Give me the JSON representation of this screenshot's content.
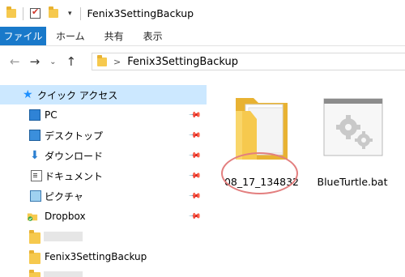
{
  "window": {
    "title": "Fenix3SettingBackup",
    "qa_dropdown": "▾"
  },
  "ribbon": {
    "tabs": [
      "ファイル",
      "ホーム",
      "共有",
      "表示"
    ]
  },
  "address": {
    "back": "←",
    "forward": "→",
    "recent": "⌄",
    "up": "↑",
    "separator": ">",
    "crumb": "Fenix3SettingBackup"
  },
  "nav": {
    "items": [
      {
        "label": "クイック アクセス",
        "icon": "star-icon",
        "selected": true
      },
      {
        "label": "PC",
        "icon": "pc-icon",
        "pinned": true
      },
      {
        "label": "デスクトップ",
        "icon": "desktop-icon",
        "pinned": true
      },
      {
        "label": "ダウンロード",
        "icon": "download-icon",
        "pinned": true
      },
      {
        "label": "ドキュメント",
        "icon": "documents-icon",
        "pinned": true
      },
      {
        "label": "ピクチャ",
        "icon": "pictures-icon",
        "pinned": true
      },
      {
        "label": "Dropbox",
        "icon": "dropbox-icon",
        "pinned": true
      },
      {
        "label": "",
        "icon": "folder-icon",
        "blurred": true
      },
      {
        "label": "Fenix3SettingBackup",
        "icon": "folder-icon"
      },
      {
        "label": "",
        "icon": "folder-icon",
        "blurred": true
      }
    ],
    "pin_glyph": "📌"
  },
  "content": {
    "items": [
      {
        "name": "08_17_134832",
        "type": "folder",
        "highlighted": true
      },
      {
        "name": "BlueTurtle.bat",
        "type": "batch-file"
      }
    ]
  },
  "colors": {
    "accent": "#1979ca",
    "selection": "#cce8ff",
    "highlight_circle": "#e37f7f",
    "folder": "#f6c94e"
  }
}
